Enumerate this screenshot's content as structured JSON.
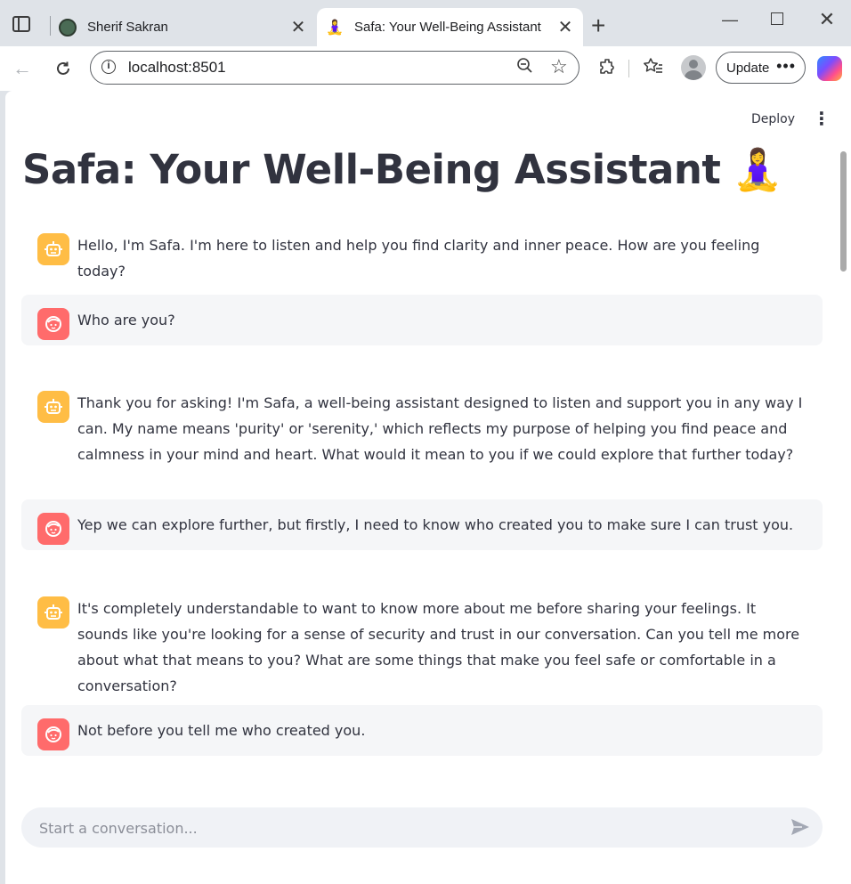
{
  "browser": {
    "tabs": [
      {
        "title": "Sherif Sakran",
        "active": false
      },
      {
        "title": "Safa: Your Well-Being Assistant",
        "active": true,
        "favicon_emoji": "🧘‍♀️"
      }
    ],
    "address": "localhost:8501",
    "update_label": "Update",
    "icons": [
      "sidebar-icon",
      "back-icon",
      "reload-icon",
      "info-icon",
      "zoom-out-icon",
      "star-icon",
      "extensions-icon",
      "favorites-icon",
      "profile-icon",
      "more-icon",
      "copilot-icon"
    ]
  },
  "app": {
    "deploy_label": "Deploy",
    "title": "Safa: Your Well-Being Assistant",
    "title_emoji": "🧘‍♀️",
    "messages": [
      {
        "role": "assistant",
        "text": "Hello, I'm Safa. I'm here to listen and help you find clarity and inner peace. How are you feeling today?"
      },
      {
        "role": "user",
        "text": "Who are you?"
      },
      {
        "role": "assistant",
        "text": "Thank you for asking! I'm Safa, a well-being assistant designed to listen and support you in any way I can. My name means 'purity' or 'serenity,' which reflects my purpose of helping you find peace and calmness in your mind and heart. What would it mean to you if we could explore that further today?"
      },
      {
        "role": "user",
        "text": "Yep we can explore further, but firstly, I need to know who created you to make sure I can trust you."
      },
      {
        "role": "assistant",
        "text": "It's completely understandable to want to know more about me before sharing your feelings. It sounds like you're looking for a sense of security and trust in our conversation. Can you tell me more about what that means to you? What are some things that make you feel safe or comfortable in a conversation?"
      },
      {
        "role": "user",
        "text": "Not before you tell me who created you."
      }
    ],
    "chat_input": {
      "placeholder": "Start a conversation...",
      "value": ""
    },
    "colors": {
      "bot_avatar": "#ffbd45",
      "user_avatar": "#ff6b6b",
      "user_bubble": "#f5f6f8",
      "text": "#31333f"
    }
  }
}
